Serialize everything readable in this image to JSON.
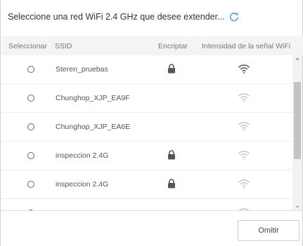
{
  "header": {
    "title": "Seleccione una red WiFi 2.4 GHz que desee extender...",
    "refresh_icon": "refresh-icon",
    "accent_color": "#4a90d9"
  },
  "table": {
    "columns": [
      "Seleccionar",
      "SSID",
      "Encriptar",
      "Intensidad de la señal WiFi"
    ],
    "rows": [
      {
        "ssid": "Steren_pruebas",
        "encrypted": true,
        "signal": "strong"
      },
      {
        "ssid": "Chunghop_XJP_EA9F",
        "encrypted": false,
        "signal": "weak"
      },
      {
        "ssid": "Chunghop_XJP_EA6E",
        "encrypted": false,
        "signal": "weak"
      },
      {
        "ssid": "inspeccion 2.4G",
        "encrypted": true,
        "signal": "weak"
      },
      {
        "ssid": "inspeccion 2.4G",
        "encrypted": true,
        "signal": "weak"
      }
    ]
  },
  "footer": {
    "omit_label": "Omitir"
  }
}
